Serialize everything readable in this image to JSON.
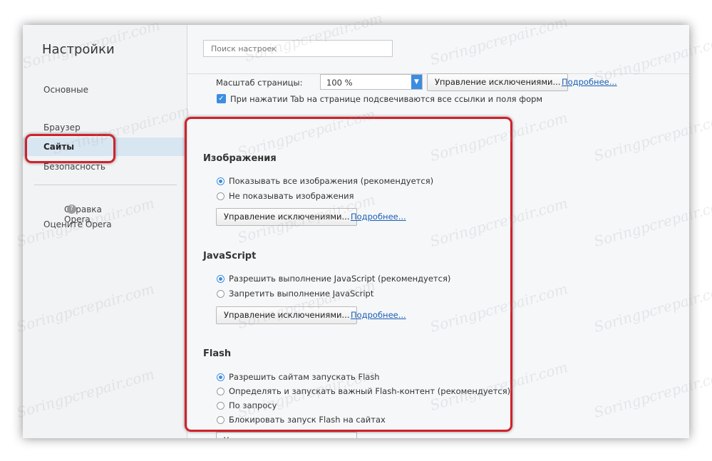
{
  "sidebar": {
    "title": "Настройки",
    "items": [
      {
        "label": "Основные"
      },
      {
        "label": "Браузер"
      },
      {
        "label": "Сайты"
      },
      {
        "label": "Безопасность"
      }
    ],
    "help_label": "Справка Opera",
    "rate_label": "Оцените Opera"
  },
  "search": {
    "placeholder": "Поиск настроек"
  },
  "zoom": {
    "label": "Масштаб страницы:",
    "value": "100 %",
    "exceptions_button": "Управление исключениями...",
    "more_link": "Подробнее..."
  },
  "tab_highlight": {
    "label": "При нажатии Tab на странице подсвечиваются все ссылки и поля форм",
    "checked": true
  },
  "images": {
    "title": "Изображения",
    "options": [
      {
        "label": "Показывать все изображения (рекомендуется)",
        "selected": true
      },
      {
        "label": "Не показывать изображения",
        "selected": false
      }
    ],
    "exceptions_button": "Управление исключениями...",
    "more_link": "Подробнее..."
  },
  "javascript": {
    "title": "JavaScript",
    "options": [
      {
        "label": "Разрешить выполнение JavaScript (рекомендуется)",
        "selected": true
      },
      {
        "label": "Запретить выполнение JavaScript",
        "selected": false
      }
    ],
    "exceptions_button": "Управление исключениями...",
    "more_link": "Подробнее..."
  },
  "flash": {
    "title": "Flash",
    "options": [
      {
        "label": "Разрешить сайтам запускать Flash",
        "selected": true
      },
      {
        "label": "Определять и запускать важный Flash-контент (рекомендуется)",
        "selected": false
      },
      {
        "label": "По запросу",
        "selected": false
      },
      {
        "label": "Блокировать запуск Flash на сайтах",
        "selected": false
      }
    ],
    "exceptions_button": "Управление исключениями..."
  },
  "watermark": "Soringpcrepair.com",
  "colors": {
    "accent": "#3c8de0",
    "highlight": "#d0222b",
    "active_item": "#d8e6f1"
  }
}
